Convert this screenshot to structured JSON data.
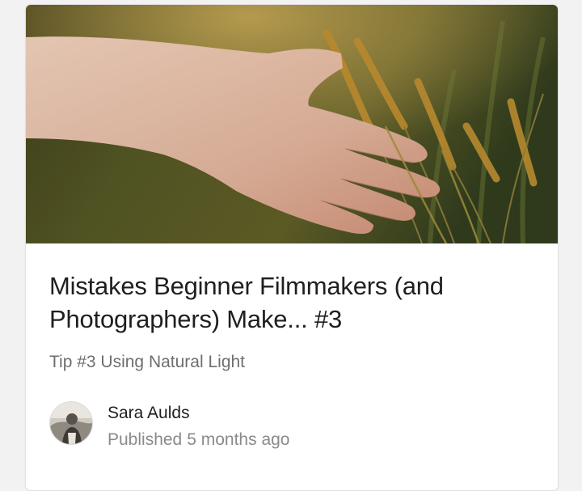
{
  "post": {
    "title": "Mistakes Beginner Filmmakers (and Photographers) Make... #3",
    "subtitle": "Tip #3 Using Natural Light",
    "image_icon": "hand-in-grass-photo"
  },
  "author": {
    "name": "Sara Aulds",
    "published_label": "Published",
    "published_time": "5 months ago",
    "avatar_icon": "avatar-photo"
  },
  "colors": {
    "card_background": "#ffffff",
    "page_background": "#f2f2f2",
    "title_text": "#1f1f1f",
    "muted_text": "#8a8a8a"
  }
}
